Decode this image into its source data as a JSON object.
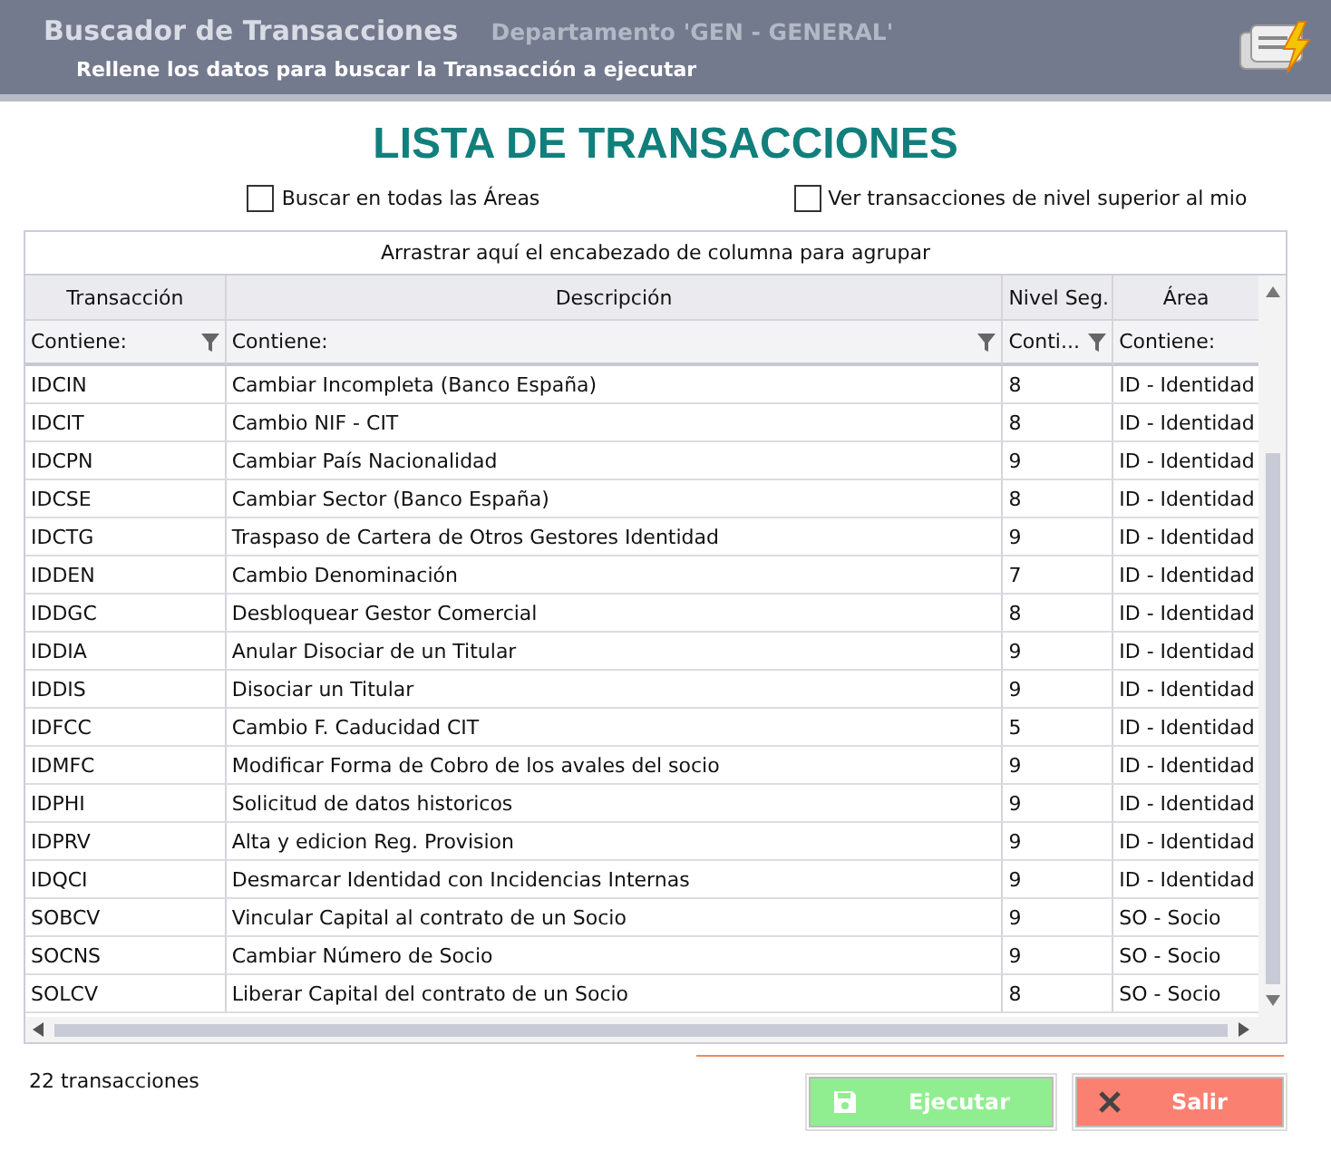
{
  "header": {
    "title": "Buscador de Transacciones",
    "department": "Departamento 'GEN - GENERAL'",
    "subtitle": "Rellene los datos para buscar la Transacción a ejecutar"
  },
  "heading": "LISTA DE TRANSACCIONES",
  "options": [
    {
      "label": "Buscar en todas las Áreas",
      "checked": false
    },
    {
      "label": "Ver transacciones de nivel superior al mio",
      "checked": false
    }
  ],
  "grid": {
    "group_hint": "Arrastrar aquí el encabezado de columna para agrupar",
    "columns": [
      {
        "label": "Transacción",
        "filter": "Contiene:",
        "funnel": true
      },
      {
        "label": "Descripción",
        "filter": "Contiene:",
        "funnel": true
      },
      {
        "label": "Nivel Seg.",
        "filter": "Conti...",
        "funnel": true
      },
      {
        "label": "Área",
        "filter": "Contiene:",
        "funnel": false
      }
    ],
    "rows": [
      [
        "IDCIN",
        "Cambiar Incompleta (Banco España)",
        "8",
        "ID - Identidad"
      ],
      [
        "IDCIT",
        "Cambio NIF - CIT",
        "8",
        "ID - Identidad"
      ],
      [
        "IDCPN",
        "Cambiar País Nacionalidad",
        "9",
        "ID - Identidad"
      ],
      [
        "IDCSE",
        "Cambiar Sector (Banco España)",
        "8",
        "ID - Identidad"
      ],
      [
        "IDCTG",
        "Traspaso de Cartera de Otros Gestores Identidad",
        "9",
        "ID - Identidad"
      ],
      [
        "IDDEN",
        "Cambio Denominación",
        "7",
        "ID - Identidad"
      ],
      [
        "IDDGC",
        "Desbloquear Gestor Comercial",
        "8",
        "ID - Identidad"
      ],
      [
        "IDDIA",
        "Anular Disociar de un Titular",
        "9",
        "ID - Identidad"
      ],
      [
        "IDDIS",
        "Disociar un Titular",
        "9",
        "ID - Identidad"
      ],
      [
        "IDFCC",
        "Cambio F. Caducidad CIT",
        "5",
        "ID - Identidad"
      ],
      [
        "IDMFC",
        "Modificar Forma de Cobro de los avales del socio",
        "9",
        "ID - Identidad"
      ],
      [
        "IDPHI",
        "Solicitud de datos historicos",
        "9",
        "ID - Identidad"
      ],
      [
        "IDPRV",
        "Alta y edicion Reg. Provision",
        "9",
        "ID - Identidad"
      ],
      [
        "IDQCI",
        "Desmarcar Identidad con Incidencias Internas",
        "9",
        "ID - Identidad"
      ],
      [
        "SOBCV",
        "Vincular Capital al contrato de un Socio",
        "9",
        "SO - Socio"
      ],
      [
        "SOCNS",
        "Cambiar Número de Socio",
        "9",
        "SO - Socio"
      ],
      [
        "SOLCV",
        "Liberar Capital del contrato de un Socio",
        "8",
        "SO - Socio"
      ]
    ]
  },
  "count": "22 transacciones",
  "buttons": [
    {
      "label": "Ejecutar",
      "kind": "save"
    },
    {
      "label": "Salir",
      "kind": "close"
    }
  ]
}
